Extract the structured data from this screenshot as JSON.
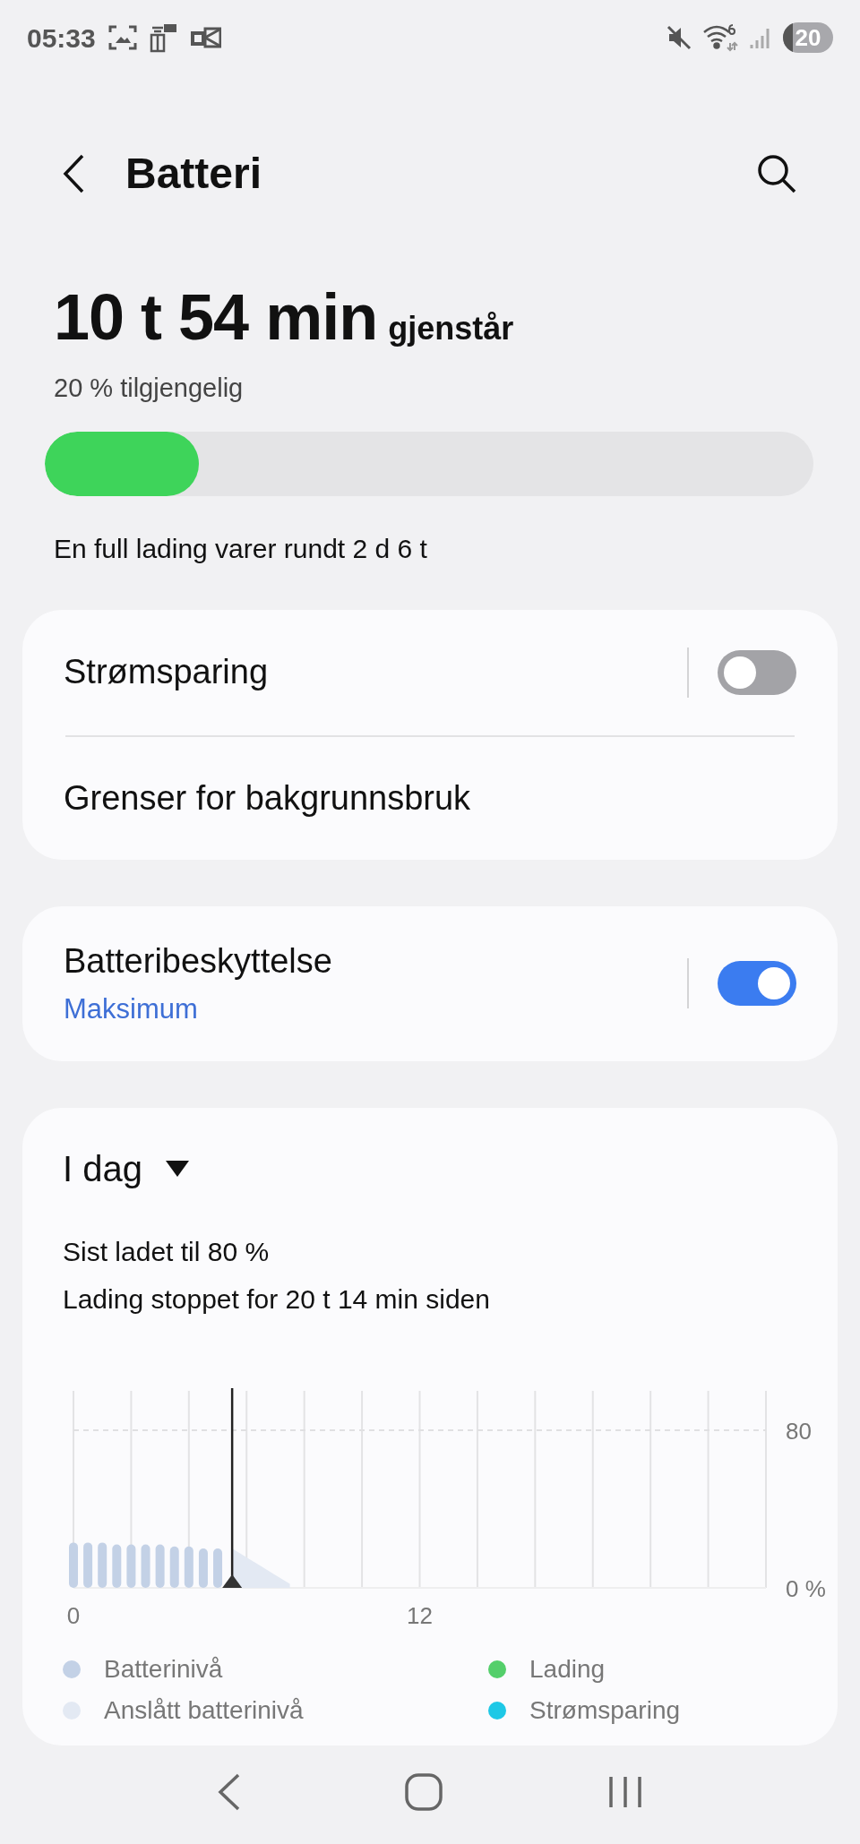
{
  "status_bar": {
    "time": "05:33",
    "battery": "20"
  },
  "header": {
    "title": "Batteri"
  },
  "summary": {
    "remaining": "10 t 54 min",
    "remaining_suffix": "gjenstår",
    "available": "20 % tilgjengelig",
    "level": 0.2,
    "full_charge": "En full lading varer rundt 2 d 6 t"
  },
  "settings_card": [
    {
      "label": "Strømsparing",
      "kind": "toggle",
      "on": false
    },
    {
      "label": "Grenser for bakgrunnsbruk",
      "kind": "link"
    }
  ],
  "protection_card": {
    "label": "Batteribeskyttelse",
    "value": "Maksimum",
    "on": true
  },
  "usage_card": {
    "period": "I dag",
    "last_charged": "Sist ladet til 80 %",
    "charging_stopped": "Lading stoppet for 20 t 14 min siden",
    "chart_data": {
      "type": "bar",
      "x": [
        0,
        0.5,
        1,
        1.5,
        2,
        2.5,
        3,
        3.5,
        4,
        4.5,
        5,
        5.5,
        6,
        6.5,
        7,
        7.5
      ],
      "series": [
        {
          "name": "Batterinivå",
          "color": "#c3d1e6",
          "values": [
            23,
            23,
            23,
            22,
            22,
            22,
            22,
            21,
            21,
            20,
            20,
            null,
            null,
            null,
            null,
            null
          ]
        },
        {
          "name": "Anslått batterinivå",
          "type": "area",
          "color": "#e3e9f3",
          "values": [
            null,
            null,
            null,
            null,
            null,
            null,
            null,
            null,
            null,
            null,
            null,
            20,
            15.5,
            11,
            6.5,
            2
          ]
        }
      ],
      "xlim": [
        0,
        24
      ],
      "ylim": [
        0,
        100
      ],
      "xticks": [
        0,
        12
      ],
      "yticks": [
        {
          "value": 0,
          "label": "0 %"
        },
        {
          "value": 80,
          "label": "80"
        }
      ],
      "ref_lines": [
        {
          "axis": "y",
          "value": 80
        },
        {
          "axis": "x",
          "value": 5.5
        }
      ]
    },
    "legend": [
      {
        "label": "Lading",
        "color": "#54cf6b"
      },
      {
        "label": "Strømsparing",
        "color": "#1ec8e6"
      }
    ]
  }
}
